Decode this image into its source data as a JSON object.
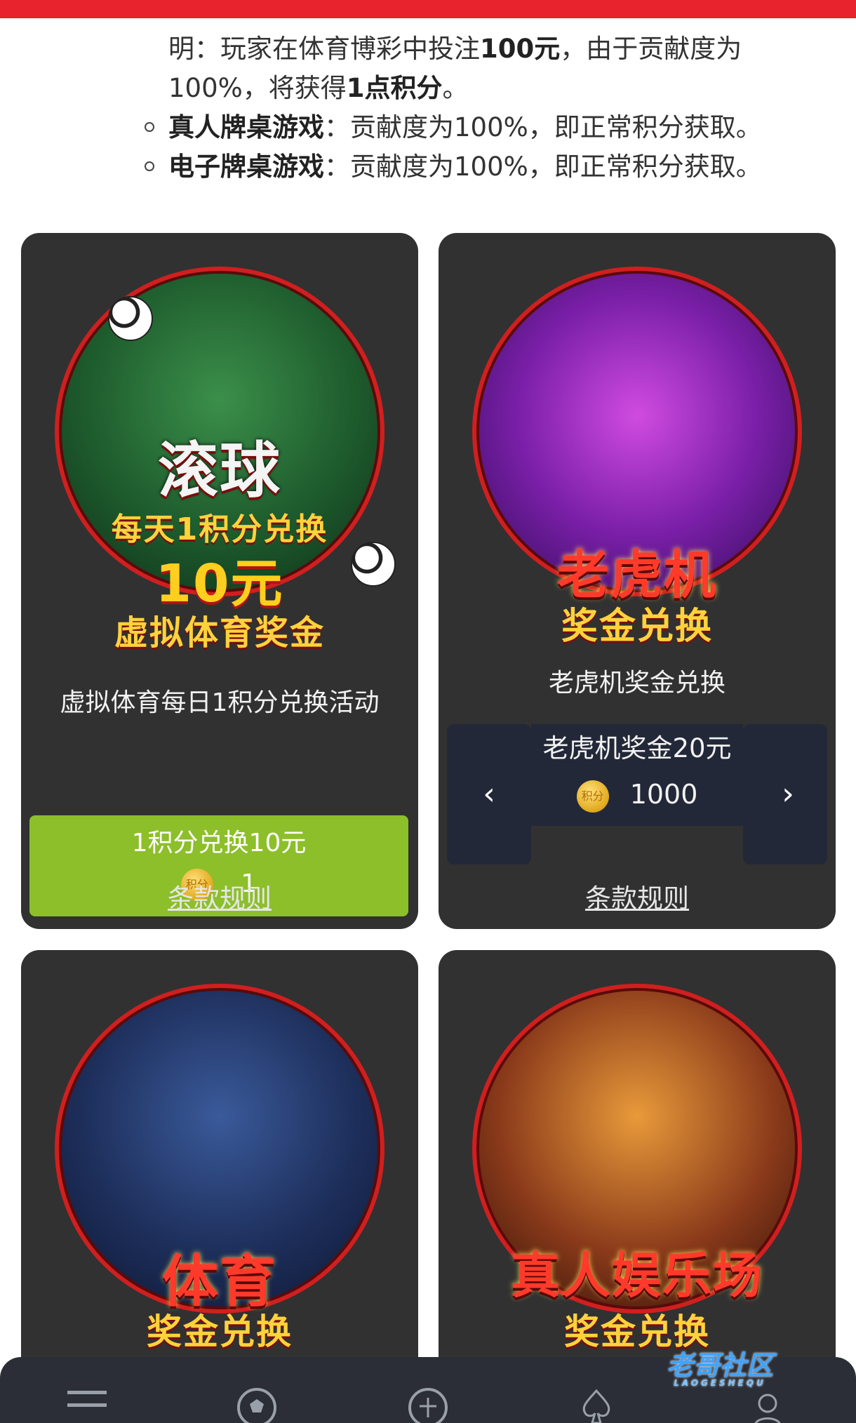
{
  "rules": {
    "line1_prefix": "明：玩家在体育博彩中投注",
    "line1_bold": "100元",
    "line1_suffix": "，由于贡献度为",
    "line2_prefix": "100%，将获得",
    "line2_bold": "1点积分",
    "line2_suffix": "。",
    "items": [
      {
        "name": "真人牌桌游戏",
        "desc": "：贡献度为100%，即正常积分获取。"
      },
      {
        "name": "电子牌桌游戏",
        "desc": "：贡献度为100%，即正常积分获取。"
      }
    ]
  },
  "cards": [
    {
      "banner_main": "滚球",
      "banner_sub1": "每天1积分兑换",
      "banner_sub2": "10元",
      "banner_sub3": "虚拟体育奖金",
      "title": "虚拟体育每日1积分兑换活动",
      "button_label": "1积分兑换10元",
      "coin_label": "积分",
      "button_value": "1",
      "terms": "条款规则"
    },
    {
      "banner_main": "老虎机",
      "banner_sub1": "奖金兑换",
      "title": "老虎机奖金兑换",
      "slide_label": "老虎机奖金20元",
      "coin_label": "积分",
      "slide_value": "1000",
      "prev": "‹",
      "next": "›",
      "terms": "条款规则"
    },
    {
      "banner_main": "体育",
      "banner_sub1": "奖金兑换"
    },
    {
      "banner_main": "真人娱乐场",
      "banner_sub1": "奖金兑换"
    }
  ],
  "watermark": {
    "title": "老哥社区",
    "sub": "LAOGESHEQU"
  },
  "icons": [
    "menu-icon",
    "soccer-ball-icon",
    "im-sports-icon",
    "spade-icon",
    "support-agent-icon"
  ],
  "colors": {
    "accent_red": "#e8232d",
    "card_bg": "#313131",
    "green": "#8cbf2a",
    "nav_bg": "#2b2e36"
  }
}
